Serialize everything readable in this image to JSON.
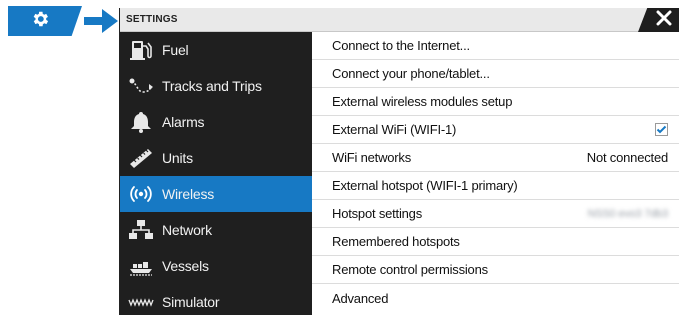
{
  "window": {
    "title": "SETTINGS"
  },
  "colors": {
    "accent": "#1779c4",
    "sidebar_bg": "#1f1f1f",
    "titlebar_bg": "#e9e9e9"
  },
  "launcher": {
    "icon": "gear-icon"
  },
  "sidebar": {
    "items": [
      {
        "label": "Fuel",
        "icon": "fuel-pump-icon",
        "active": false
      },
      {
        "label": "Tracks and Trips",
        "icon": "track-icon",
        "active": false
      },
      {
        "label": "Alarms",
        "icon": "bell-icon",
        "active": false
      },
      {
        "label": "Units",
        "icon": "ruler-icon",
        "active": false
      },
      {
        "label": "Wireless",
        "icon": "wireless-icon",
        "active": true
      },
      {
        "label": "Network",
        "icon": "network-icon",
        "active": false
      },
      {
        "label": "Vessels",
        "icon": "vessels-icon",
        "active": false
      },
      {
        "label": "Simulator",
        "icon": "simulator-wave-icon",
        "active": false
      }
    ]
  },
  "settings": {
    "rows": [
      {
        "label": "Connect to the Internet..."
      },
      {
        "label": "Connect your phone/tablet..."
      },
      {
        "label": "External wireless modules setup"
      },
      {
        "label": "External WiFi (WIFI-1)",
        "checked": true
      },
      {
        "label": "WiFi networks",
        "value": "Not connected"
      },
      {
        "label": "External hotspot (WIFI-1 primary)"
      },
      {
        "label": "Hotspot settings",
        "value": "NSS0 evo3 7db3"
      },
      {
        "label": "Remembered hotspots"
      },
      {
        "label": "Remote control permissions"
      },
      {
        "label": "Advanced"
      }
    ]
  }
}
